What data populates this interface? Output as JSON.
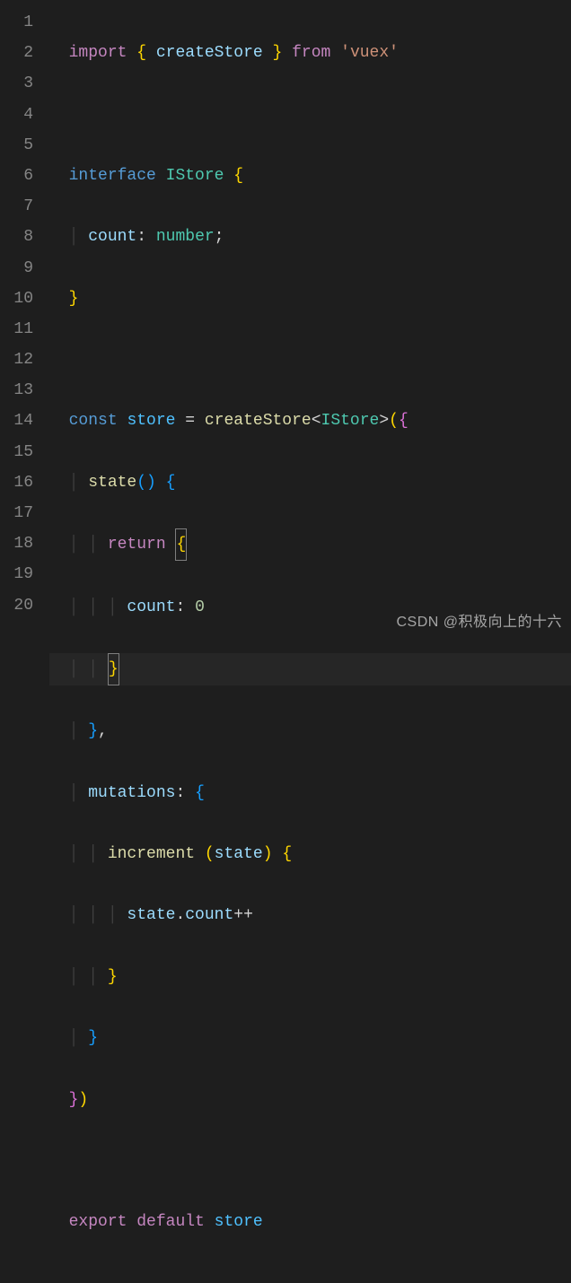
{
  "watermark": "CSDN @积极向上的十六",
  "line_numbers": [
    "1",
    "2",
    "3",
    "4",
    "5",
    "6",
    "7",
    "8",
    "9",
    "10",
    "11",
    "12",
    "13",
    "14",
    "15",
    "16",
    "17",
    "18",
    "19",
    "20"
  ],
  "tokens": {
    "l1_import": "import",
    "l1_brace_open": "{",
    "l1_createStore": "createStore",
    "l1_brace_close": "}",
    "l1_from": "from",
    "l1_vuex": "'vuex'",
    "l3_interface": "interface",
    "l3_IStore": "IStore",
    "l3_brace": "{",
    "l4_count": "count",
    "l4_colon": ":",
    "l4_number": "number",
    "l4_semi": ";",
    "l5_brace": "}",
    "l7_const": "const",
    "l7_store": "store",
    "l7_eq": "=",
    "l7_createStore": "createStore",
    "l7_lt": "<",
    "l7_IStore": "IStore",
    "l7_gt": ">",
    "l7_paren": "(",
    "l7_brace": "{",
    "l8_state": "state",
    "l8_paren_open": "(",
    "l8_paren_close": ")",
    "l8_brace": "{",
    "l9_return": "return",
    "l9_brace": "{",
    "l10_count": "count",
    "l10_colon": ":",
    "l10_zero": "0",
    "l11_brace": "}",
    "l12_brace": "}",
    "l12_comma": ",",
    "l13_mutations": "mutations",
    "l13_colon": ":",
    "l13_brace": "{",
    "l14_increment": "increment",
    "l14_paren_open": "(",
    "l14_state": "state",
    "l14_paren_close": ")",
    "l14_brace": "{",
    "l15_state": "state",
    "l15_dot": ".",
    "l15_count": "count",
    "l15_pp": "++",
    "l16_brace": "}",
    "l17_brace": "}",
    "l18_brace": "}",
    "l18_paren": ")",
    "l20_export": "export",
    "l20_default": "default",
    "l20_store": "store"
  },
  "chart_data": {
    "type": "table",
    "title": "TypeScript source code (VS Code editor view)",
    "language": "typescript",
    "lines": [
      "import { createStore } from 'vuex'",
      "",
      "interface IStore {",
      "  count: number;",
      "}",
      "",
      "const store = createStore<IStore>({",
      "  state() {",
      "    return {",
      "      count: 0",
      "    }",
      "  },",
      "  mutations: {",
      "    increment (state) {",
      "      state.count++",
      "    }",
      "  }",
      "})",
      "",
      "export default store"
    ]
  }
}
